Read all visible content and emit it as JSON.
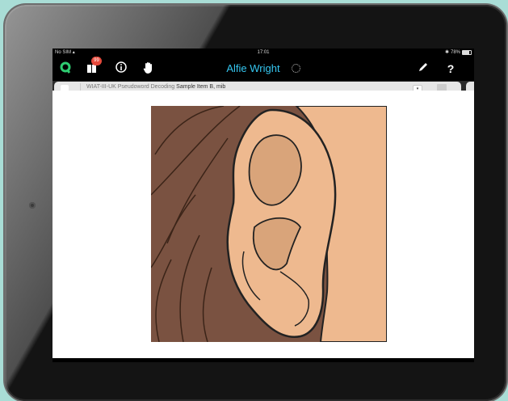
{
  "status_bar": {
    "carrier": "No SIM",
    "time": "17:01",
    "battery": "78%",
    "battery_level": 0.78,
    "icons": [
      "wifi-icon",
      "bluetooth-icon",
      "battery-icon"
    ]
  },
  "nav": {
    "title": "Alfie Wright",
    "badge_count": "99",
    "icons": [
      "q-logo-icon",
      "stimulus-book-icon",
      "info-icon",
      "hand-icon",
      "pencil-icon",
      "help-icon"
    ],
    "title_color": "#35c6f0",
    "q_icon_color": "#2ecc71",
    "badge_color": "#e64a3c"
  },
  "tab": {
    "subtest": "WIAT-III-UK Pseudoword Decoding",
    "item": "Sample Item B, mib"
  },
  "stimulus": {
    "subject": "ear",
    "colors": {
      "hair": "#7a5241",
      "skin": "#eeb98f",
      "ear_inner": "#d9a47a",
      "outline": "#222222"
    }
  }
}
